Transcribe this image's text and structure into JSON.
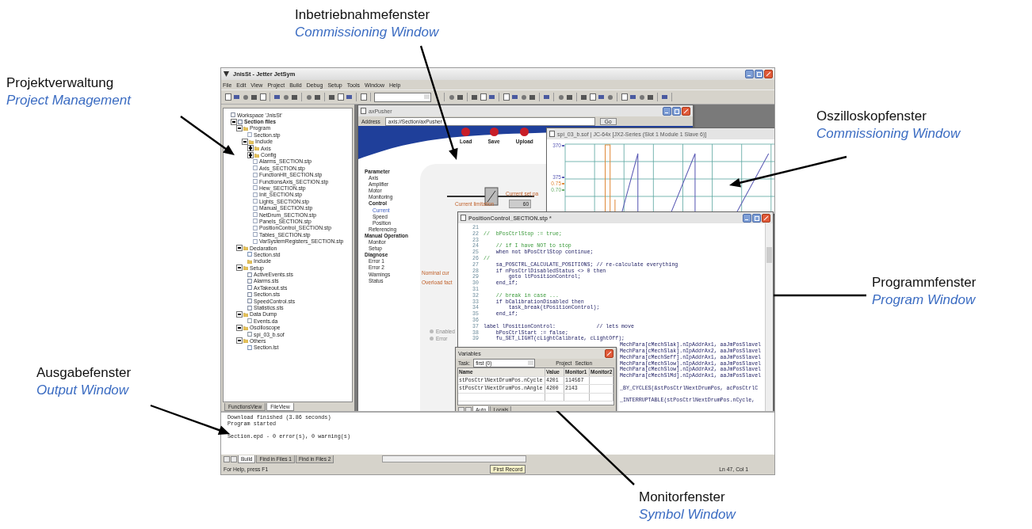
{
  "annotations": [
    {
      "title": "Projektverwaltung",
      "subtitle": "Project Management"
    },
    {
      "title": "Inbetriebnahmefenster",
      "subtitle": "Commissioning Window"
    },
    {
      "title": "Oszilloskopfenster",
      "subtitle": "Commissioning  Window"
    },
    {
      "title": "Programmfenster",
      "subtitle": "Program Window"
    },
    {
      "title": "Ausgabefenster",
      "subtitle": "Output Window"
    },
    {
      "title": "Monitorfenster",
      "subtitle": "Symbol Window"
    }
  ],
  "app": {
    "title": "JnisSt - Jetter JetSym",
    "menu": [
      "File",
      "Edit",
      "View",
      "Project",
      "Build",
      "Debug",
      "Setup",
      "Tools",
      "Window",
      "Help"
    ],
    "workspace": {
      "tree": [
        {
          "label": "Workspace 'JnisSt'",
          "kind": "workspace",
          "children": [
            {
              "label": "Section files",
              "kind": "group",
              "expanded": true,
              "children": [
                {
                  "label": "Program",
                  "kind": "folder",
                  "expanded": true,
                  "children": [
                    {
                      "label": "Section.stp",
                      "kind": "source"
                    },
                    {
                      "label": "Include",
                      "kind": "folder",
                      "expanded": true,
                      "children": [
                        {
                          "label": "Axis",
                          "kind": "folder",
                          "expanded": false
                        },
                        {
                          "label": "Config",
                          "kind": "folder",
                          "expanded": false
                        },
                        {
                          "label": "Alarms_SECTION.stp",
                          "kind": "source"
                        },
                        {
                          "label": "Axis_SECTION.stp",
                          "kind": "source"
                        },
                        {
                          "label": "FunctionHlt_SECTION.stp",
                          "kind": "source"
                        },
                        {
                          "label": "FunctionsAxis_SECTION.stp",
                          "kind": "source"
                        },
                        {
                          "label": "Hew_SECTION.stp",
                          "kind": "source"
                        },
                        {
                          "label": "Init_SECTION.stp",
                          "kind": "source"
                        },
                        {
                          "label": "Lights_SECTION.stp",
                          "kind": "source"
                        },
                        {
                          "label": "Manual_SECTION.stp",
                          "kind": "source"
                        },
                        {
                          "label": "NetDrum_SECTION.stp",
                          "kind": "source"
                        },
                        {
                          "label": "Panels_SECTION.stp",
                          "kind": "source"
                        },
                        {
                          "label": "PositionControl_SECTION.stp",
                          "kind": "source"
                        },
                        {
                          "label": "Tables_SECTION.stp",
                          "kind": "source"
                        },
                        {
                          "label": "VarSystemRegisters_SECTION.stp",
                          "kind": "source"
                        }
                      ]
                    }
                  ]
                },
                {
                  "label": "Declaration",
                  "kind": "folder",
                  "expanded": true,
                  "children": [
                    {
                      "label": "Section.std",
                      "kind": "table"
                    },
                    {
                      "label": "Include",
                      "kind": "folder"
                    }
                  ]
                },
                {
                  "label": "Setup",
                  "kind": "folder",
                  "expanded": true,
                  "children": [
                    {
                      "label": "ActiveEvents.sts",
                      "kind": "setup"
                    },
                    {
                      "label": "Alarms.sts",
                      "kind": "setup"
                    },
                    {
                      "label": "AxTakeout.sts",
                      "kind": "setup"
                    },
                    {
                      "label": "Section.sts",
                      "kind": "setup"
                    },
                    {
                      "label": "SpeedControl.sts",
                      "kind": "setup"
                    },
                    {
                      "label": "Statistics.sts",
                      "kind": "setup"
                    }
                  ]
                },
                {
                  "label": "Data Dump",
                  "kind": "folder",
                  "expanded": true,
                  "children": [
                    {
                      "label": "Events.da",
                      "kind": "data"
                    }
                  ]
                },
                {
                  "label": "Oscilloscope",
                  "kind": "folder",
                  "expanded": true,
                  "children": [
                    {
                      "label": "spi_03_b.sof",
                      "kind": "scope"
                    }
                  ]
                },
                {
                  "label": "Others",
                  "kind": "folder",
                  "expanded": true,
                  "children": [
                    {
                      "label": "Section.lst",
                      "kind": "table"
                    }
                  ]
                }
              ]
            }
          ]
        }
      ],
      "tabs": [
        {
          "label": "FunctionsView",
          "selected": false
        },
        {
          "label": "FileView",
          "selected": true
        }
      ]
    },
    "commissioning_window": {
      "title": "axPusher",
      "address_label": "Address",
      "address": "axis://Section/axPusher",
      "go": "Go",
      "actions": [
        "Load",
        "Save",
        "Upload"
      ],
      "nav": [
        {
          "label": "Parameter",
          "selected": false,
          "children": [
            {
              "label": "Axis",
              "selected": false
            },
            {
              "label": "Amplifier",
              "selected": false
            },
            {
              "label": "Motor",
              "selected": false
            },
            {
              "label": "Monitoring",
              "selected": false
            },
            {
              "label": "Control",
              "selected": false,
              "children": [
                {
                  "label": "Current",
                  "selected": true
                },
                {
                  "label": "Speed",
                  "selected": false
                },
                {
                  "label": "Position",
                  "selected": false
                }
              ]
            },
            {
              "label": "Referencing",
              "selected": false
            }
          ]
        },
        {
          "label": "Manual Operation",
          "selected": false,
          "children": [
            {
              "label": "Monitor",
              "selected": false
            },
            {
              "label": "Setup",
              "selected": false
            }
          ]
        },
        {
          "label": "Diagnose",
          "selected": false,
          "children": [
            {
              "label": "Error 1",
              "selected": false
            },
            {
              "label": "Error 2",
              "selected": false
            },
            {
              "label": "Warnings",
              "selected": false
            },
            {
              "label": "Status",
              "selected": false
            }
          ]
        }
      ],
      "labels": {
        "set_point": "Current set pa",
        "limitation": "Current limitation",
        "limitation_value": "60",
        "nominal": "Nominal cur",
        "overload": "Overload fact"
      },
      "indicators": [
        "Enabled",
        "Error"
      ]
    },
    "oscilloscope_window": {
      "title": "spi_03_b.sof | JC-64x [JX2-Series (Slot 1 Module 1 Slave 6)]",
      "axis_labels": [
        {
          "text": "370",
          "color": "#5a5ab4"
        },
        {
          "text": "375",
          "color": "#5a5ab4"
        },
        {
          "text": "0.75",
          "color": "#e08a3a"
        },
        {
          "text": "0.70",
          "color": "#6aae6a"
        }
      ]
    },
    "program_window": {
      "title": "PositionControl_SECTION.stp *",
      "lines": [
        {
          "number": "21",
          "kind": "code"
        },
        {
          "number": "22",
          "kind": "comment",
          "text": "//  bPosCtrlStop := true;"
        },
        {
          "number": "23",
          "kind": "code"
        },
        {
          "number": "24",
          "kind": "comment",
          "text": "    // if I have NOT to stop"
        },
        {
          "number": "25",
          "kind": "code",
          "text": "    when not bPosCtrlStop continue;"
        },
        {
          "number": "26",
          "kind": "comment",
          "text": "//"
        },
        {
          "number": "27",
          "kind": "code",
          "text": "    sa_POSCTRL_CALCULATE_POSITIONS; // re-calculate everything"
        },
        {
          "number": "28",
          "kind": "code",
          "text": "    if nPosCtrlDisabledStatus <> 0 then"
        },
        {
          "number": "29",
          "kind": "code",
          "text": "        goto ltPositionControl;"
        },
        {
          "number": "30",
          "kind": "code",
          "text": "    end_if;"
        },
        {
          "number": "31",
          "kind": "code"
        },
        {
          "number": "32",
          "kind": "comment",
          "text": "    // break in case ..."
        },
        {
          "number": "33",
          "kind": "code",
          "text": "    if bCalibrationDisabled then"
        },
        {
          "number": "34",
          "kind": "code",
          "text": "        task_break(tPositionControl);"
        },
        {
          "number": "35",
          "kind": "code",
          "text": "    end_if;"
        },
        {
          "number": "36",
          "kind": "code"
        },
        {
          "number": "37",
          "kind": "code",
          "text": "label lPositionControl:             // lets move"
        },
        {
          "number": "38",
          "kind": "code",
          "text": "    bPosCtrlStart := false;"
        },
        {
          "number": "39",
          "kind": "code",
          "text": "    fu_SET_LIGHT(cLightCalibrate, cLightOff);"
        },
        {
          "kind": "covered",
          "text": "MechPara[cMechSlak].nIpAddrAx1, aaJmPosSlavel"
        },
        {
          "kind": "covered",
          "text": "MechPara[cMechSlak].nIpAddrAx2, aaJmPosSlavel"
        },
        {
          "kind": "covered",
          "text": "MechPara[cMechSeff].nIpAddrAx1, aaJmPosSlavel"
        },
        {
          "kind": "covered",
          "text": "MechPara[cMechSlow].nIpAddrAx1, aaJmPosSlavel"
        },
        {
          "kind": "covered",
          "text": "MechPara[cMechSlow].nIpAddrAx2, aaJmPosSlavel"
        },
        {
          "kind": "covered",
          "text": "MechPara[cMechSlMd].nIpAddrAx1, aaJmPosSlavel"
        },
        {
          "kind": "covered"
        },
        {
          "kind": "covered",
          "text": "_BY_CYCLES(&stPosCtrlNextDrumPos, acPosCtrlC"
        },
        {
          "kind": "covered"
        },
        {
          "kind": "covered",
          "text": "_INTERRUPTABLE(stPosCtrlNextDrumPos.nCycle, "
        }
      ]
    },
    "variables_window": {
      "title": "Variables",
      "task_label": "Task:",
      "task": "first (0)",
      "project_label": "Project",
      "project": "Section",
      "columns": [
        "Name",
        "Value",
        "Monitor1",
        "Monitor2"
      ],
      "rows": [
        [
          "stPosCtrlNextDrumPos.nCycle",
          "4201",
          "114567",
          ""
        ],
        [
          "stPosCtrlNextDrumPos.nAngle",
          "4200",
          "2143",
          ""
        ]
      ],
      "tabs": [
        {
          "label": "Auto",
          "selected": true
        },
        {
          "label": "Locals",
          "selected": false
        }
      ]
    },
    "output": {
      "messages": [
        "Download finished (3.86 seconds)",
        "Program started"
      ],
      "summary": "Section.epd - 0 error(s), 0 warning(s)",
      "tabs": [
        {
          "label": "Build",
          "selected": true
        },
        {
          "label": "Find in Files 1",
          "selected": false
        },
        {
          "label": "Find in Files 2",
          "selected": false
        }
      ]
    },
    "status_bar": {
      "help": "For Help, press F1",
      "record": "First Record",
      "position": "Ln 47, Col 1"
    }
  }
}
